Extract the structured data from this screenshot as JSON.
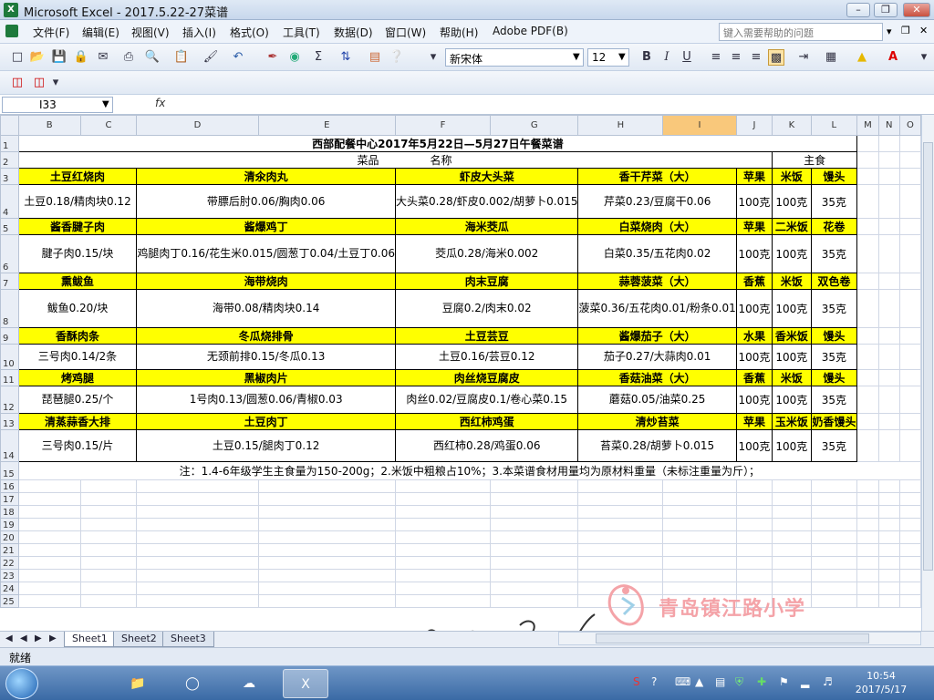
{
  "window": {
    "title": "Microsoft Excel - 2017.5.22-27菜谱",
    "app_icon": "X"
  },
  "menu": [
    "文件(F)",
    "编辑(E)",
    "视图(V)",
    "插入(I)",
    "格式(O)",
    "工具(T)",
    "数据(D)",
    "窗口(W)",
    "帮助(H)",
    "Adobe PDF(B)"
  ],
  "help_placeholder": "键入需要帮助的问题",
  "font": {
    "name": "新宋体",
    "size": "12"
  },
  "name_box": "I33",
  "fx_label": "fx",
  "columns": [
    "B",
    "C",
    "D",
    "E",
    "F",
    "G",
    "H",
    "I",
    "J",
    "K",
    "L",
    "M",
    "N",
    "O"
  ],
  "selected_column": "I",
  "row_numbers": [
    "1",
    "2",
    "3",
    "4",
    "5",
    "6",
    "7",
    "8",
    "9",
    "10",
    "11",
    "12",
    "13",
    "14",
    "15",
    "16",
    "17",
    "18",
    "19",
    "20",
    "21",
    "22",
    "23",
    "24",
    "25"
  ],
  "sheet": {
    "title": "西部配餐中心2017年5月22日—5月27日午餐菜谱",
    "header_dish": "菜品",
    "header_name": "名称",
    "header_staple": "主食",
    "menu_rows": [
      {
        "dishes": [
          "土豆红烧肉",
          "清氽肉丸",
          "虾皮大头菜",
          "香干芹菜（大）"
        ],
        "fruit": "苹果",
        "staple1": "米饭",
        "staple2": "馒头",
        "ingredients": [
          "土豆0.18/精肉块0.12",
          "带膘后肘0.06/胸肉0.06",
          "大头菜0.28/虾皮0.002/胡萝卜0.015",
          "芹菜0.23/豆腐干0.06"
        ],
        "amounts": [
          "100克",
          "100克",
          "35克"
        ]
      },
      {
        "dishes": [
          "酱香腱子肉",
          "酱爆鸡丁",
          "海米茭瓜",
          "白菜烧肉（大）"
        ],
        "fruit": "苹果",
        "staple1": "二米饭",
        "staple2": "花卷",
        "ingredients": [
          "腱子肉0.15/块",
          "鸡腿肉丁0.16/花生米0.015/圆葱丁0.04/土豆丁0.06",
          "茭瓜0.28/海米0.002",
          "白菜0.35/五花肉0.02"
        ],
        "amounts": [
          "100克",
          "100克",
          "35克"
        ]
      },
      {
        "dishes": [
          "熏鲅鱼",
          "海带烧肉",
          "肉末豆腐",
          "蒜蓉菠菜（大）"
        ],
        "fruit": "香蕉",
        "staple1": "米饭",
        "staple2": "双色卷",
        "ingredients": [
          "鲅鱼0.20/块",
          "海带0.08/精肉块0.14",
          "豆腐0.2/肉末0.02",
          "菠菜0.36/五花肉0.01/粉条0.01"
        ],
        "amounts": [
          "100克",
          "100克",
          "35克"
        ]
      },
      {
        "dishes": [
          "香酥肉条",
          "冬瓜烧排骨",
          "土豆芸豆",
          "酱爆茄子（大）"
        ],
        "fruit": "水果",
        "staple1": "香米饭",
        "staple2": "馒头",
        "ingredients": [
          "三号肉0.14/2条",
          "无颈前排0.15/冬瓜0.13",
          "土豆0.16/芸豆0.12",
          "茄子0.27/大蒜肉0.01"
        ],
        "amounts": [
          "100克",
          "100克",
          "35克"
        ]
      },
      {
        "dishes": [
          "烤鸡腿",
          "黑椒肉片",
          "肉丝烧豆腐皮",
          "香菇油菜（大）"
        ],
        "fruit": "香蕉",
        "staple1": "米饭",
        "staple2": "馒头",
        "ingredients": [
          "琵琶腿0.25/个",
          "1号肉0.13/圆葱0.06/青椒0.03",
          "肉丝0.02/豆腐皮0.1/卷心菜0.15",
          "蘑菇0.05/油菜0.25"
        ],
        "amounts": [
          "100克",
          "100克",
          "35克"
        ]
      },
      {
        "dishes": [
          "清蒸蒜香大排",
          "土豆肉丁",
          "西红柿鸡蛋",
          "清炒苔菜"
        ],
        "fruit": "苹果",
        "staple1": "玉米饭",
        "staple2": "奶香馒头",
        "ingredients": [
          "三号肉0.15/片",
          "土豆0.15/腿肉丁0.12",
          "西红柿0.28/鸡蛋0.06",
          "苔菜0.28/胡萝卜0.015"
        ],
        "amounts": [
          "100克",
          "100克",
          "35克"
        ]
      }
    ],
    "note": "注：1.4-6年级学生主食量为150-200g；2.米饭中粗粮占10%；3.本菜谱食材用量均为原材料重量（未标注重量为斤）；"
  },
  "watermark_text": "青岛镇江路小学",
  "sheet_tabs": [
    "Sheet1",
    "Sheet2",
    "Sheet3"
  ],
  "active_tab": "Sheet1",
  "status": "就绪",
  "clock": {
    "time": "10:54",
    "date": "2017/5/17"
  },
  "colors": {
    "dish_highlight": "#ffff00",
    "selected_header": "#f9c87b",
    "logo_pink": "#f4a3a8"
  }
}
